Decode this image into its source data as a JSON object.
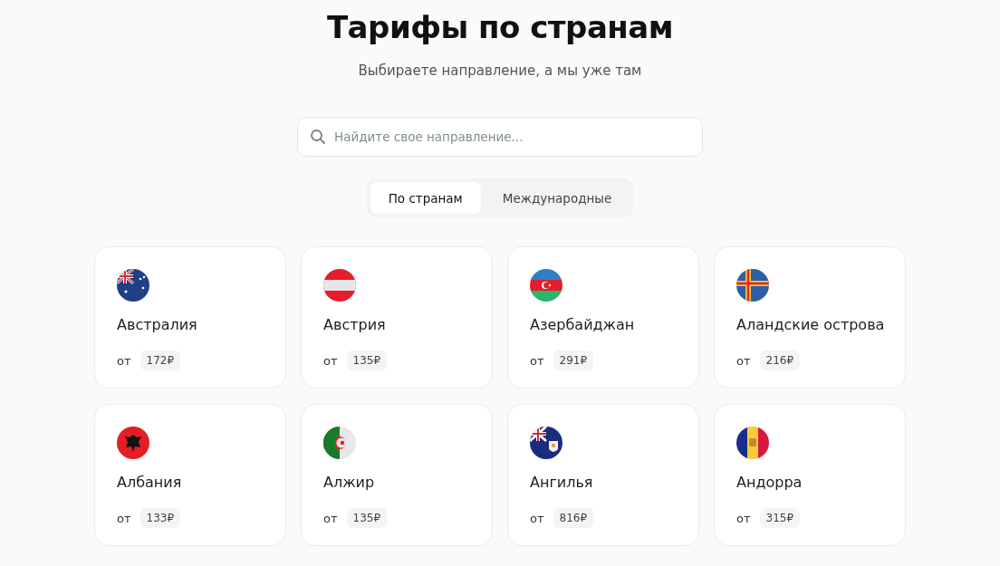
{
  "header": {
    "title": "Тарифы по странам",
    "subtitle": "Выбираете направление, а мы уже там"
  },
  "search": {
    "placeholder": "Найдите свое направление..."
  },
  "tabs": [
    {
      "label": "По странам",
      "selected": true
    },
    {
      "label": "Международные",
      "selected": false
    }
  ],
  "countries": [
    {
      "name": "Австралия",
      "prefix": "от",
      "price": "172₽"
    },
    {
      "name": "Австрия",
      "prefix": "от",
      "price": "135₽"
    },
    {
      "name": "Азербайджан",
      "prefix": "от",
      "price": "291₽"
    },
    {
      "name": "Аландские острова",
      "prefix": "от",
      "price": "216₽"
    },
    {
      "name": "Албания",
      "prefix": "от",
      "price": "133₽"
    },
    {
      "name": "Алжир",
      "prefix": "от",
      "price": "135₽"
    },
    {
      "name": "Ангилья",
      "prefix": "от",
      "price": "816₽"
    },
    {
      "name": "Андорра",
      "prefix": "от",
      "price": "315₽"
    }
  ]
}
